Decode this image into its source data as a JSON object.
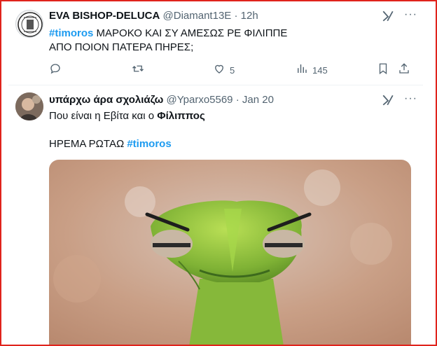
{
  "tweet1": {
    "display_name": "EVA BISHOP-DELUCA",
    "handle": "@Diamant13E",
    "separator": "·",
    "time": "12h",
    "hashtag": "#timoros",
    "text_line1": "ΜΑΡΟΚΟ ΚΑΙ ΣΥ ΑΜΕΣΩΣ ΡΕ ΦΙΛΙΠΠΕ",
    "text_line2": "ΑΠΟ ΠΟΙΟΝ ΠΑΤΕΡΑ ΠΗΡΕΣ;",
    "likes": "5",
    "views": "145",
    "icons": [
      "reply-icon",
      "retweet-icon",
      "like-icon",
      "views-icon",
      "bookmark-icon",
      "share-icon",
      "grok-icon",
      "more-icon"
    ]
  },
  "tweet2": {
    "display_name": "υπάρχω άρα σχολιάζω",
    "handle": "@Yparxo5569",
    "separator": "·",
    "time": "Jan 20",
    "text_line1_prefix": "Που είναι η Εβίτα και ο ",
    "text_line1_bold": "Φίλιππος",
    "text_line2": "ΗΡΕΜΑ ΡΩΤΑΩ ",
    "hashtag": "#timoros",
    "media": "angry green snake photo",
    "icons": [
      "grok-icon",
      "more-icon"
    ]
  },
  "colors": {
    "accent": "#1d9bf0",
    "muted": "#536471",
    "text": "#0f1419",
    "frame": "#e0231c"
  }
}
